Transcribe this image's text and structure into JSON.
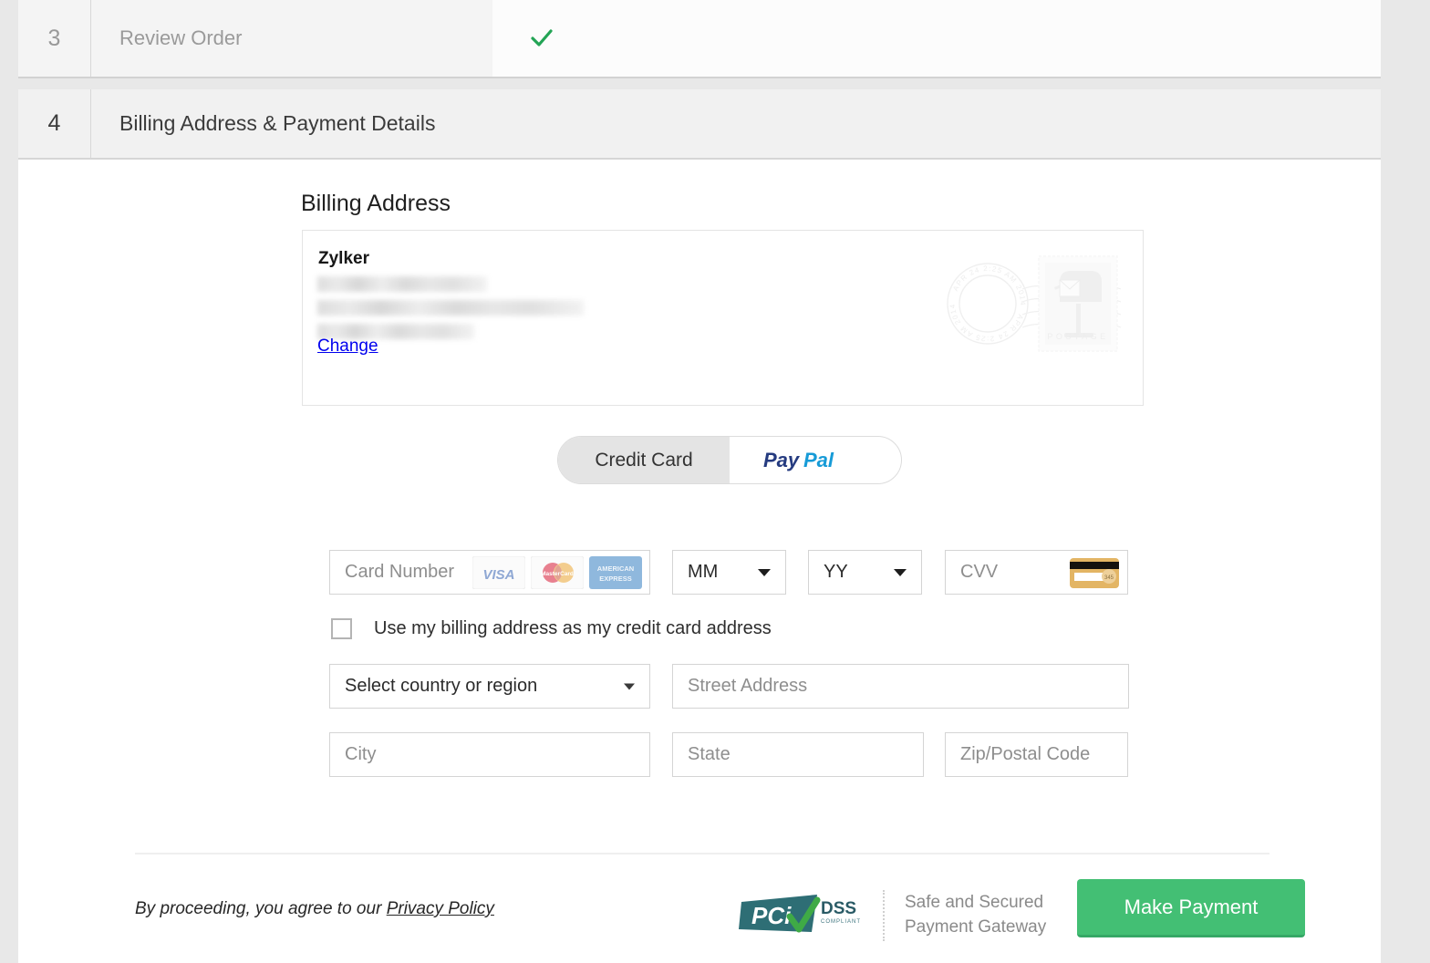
{
  "steps": [
    {
      "number": "3",
      "label": "Review Order",
      "state": "completed",
      "check_icon": "check-mark-icon"
    },
    {
      "number": "4",
      "label": "Billing Address & Payment Details",
      "state": "current"
    }
  ],
  "section": {
    "title": "Billing Address"
  },
  "billing_address": {
    "name": "Zylker",
    "lines_redacted": [
      "redacted-line-1",
      "redacted-line-2",
      "redacted-line-3"
    ],
    "change_label": "Change",
    "stamp": {
      "postmark_text": "APR 24 2:25 AM 2014",
      "postage_label": "POSTAGE",
      "icon": "mailbox-stamp-icon"
    }
  },
  "payment_methods": {
    "tabs": [
      {
        "id": "credit-card",
        "label": "Credit Card",
        "selected": true
      },
      {
        "id": "paypal",
        "label": "PayPal",
        "selected": false
      }
    ]
  },
  "card_form": {
    "card_number_placeholder": "Card Number",
    "accepted_brands": [
      "VISA",
      "MasterCard",
      "AMERICAN EXPRESS"
    ],
    "month_value": "MM",
    "year_value": "YY",
    "cvv_placeholder": "CVV",
    "cvv_icon": "credit-card-back-icon",
    "use_billing_checkbox": {
      "label": "Use my billing address as my credit card address",
      "checked": false
    },
    "country_value": "Select country or region",
    "street_placeholder": "Street Address",
    "city_placeholder": "City",
    "state_placeholder": "State",
    "zip_placeholder": "Zip/Postal Code"
  },
  "footer": {
    "legal_prefix": "By proceeding, you agree to our ",
    "privacy_policy_label": "Privacy Policy",
    "pci": {
      "mark": "PCI",
      "standard": "DSS",
      "compliant": "COMPLIANT",
      "tagline_line1": "Safe and Secured",
      "tagline_line2": "Payment Gateway"
    },
    "pay_button_label": "Make Payment"
  },
  "colors": {
    "page_background": "#e8e8e8",
    "panel_background": "#ffffff",
    "step_current_background": "#f1f1f1",
    "step_done_background": "#f4f4f4",
    "check_green": "#23a455",
    "link_blue": "#0000ee",
    "pay_button_green": "#43bf74",
    "paypal_dark_blue": "#253b80",
    "paypal_light_blue": "#179bd7",
    "pci_teal": "#2e6e75"
  }
}
